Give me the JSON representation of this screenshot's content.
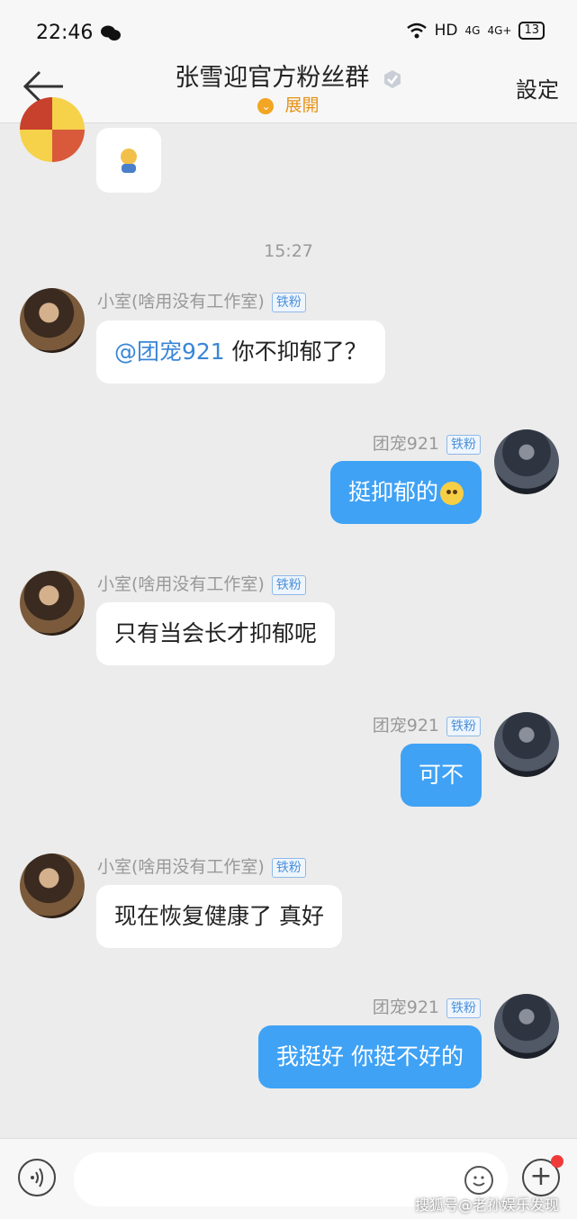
{
  "status_bar": {
    "time": "22:46",
    "network": "HD",
    "signal1": "4G",
    "signal2": "4G+",
    "battery": "13"
  },
  "header": {
    "title": "张雪迎官方粉丝群",
    "expand_label": "展開",
    "settings_label": "設定"
  },
  "timestamp": "15:27",
  "messages": [
    {
      "side": "in",
      "sender": "小室(啥用没有工作室)",
      "tag": "铁粉",
      "mention": "@团宠921",
      "text": "你不抑郁了？"
    },
    {
      "side": "out",
      "sender": "团宠921",
      "tag": "铁粉",
      "text": "挺抑郁的"
    },
    {
      "side": "in",
      "sender": "小室(啥用没有工作室)",
      "tag": "铁粉",
      "text": "只有当会长才抑郁呢"
    },
    {
      "side": "out",
      "sender": "团宠921",
      "tag": "铁粉",
      "text": "可不"
    },
    {
      "side": "in",
      "sender": "小室(啥用没有工作室)",
      "tag": "铁粉",
      "text": "现在恢复健康了 真好"
    },
    {
      "side": "out",
      "sender": "团宠921",
      "tag": "铁粉",
      "text": "我挺好 你挺不好的"
    }
  ],
  "watermark": "搜狐号@老孙娱乐发现",
  "icons": {
    "back": "arrow-left-icon",
    "verify": "verified-badge-icon",
    "voice": "voice-icon",
    "emoji": "emoji-icon",
    "plus": "plus-icon"
  },
  "colors": {
    "out_bubble": "#3fa2f5",
    "in_bubble": "#ffffff",
    "tag": "#4a90d9",
    "expand": "#e69317"
  }
}
